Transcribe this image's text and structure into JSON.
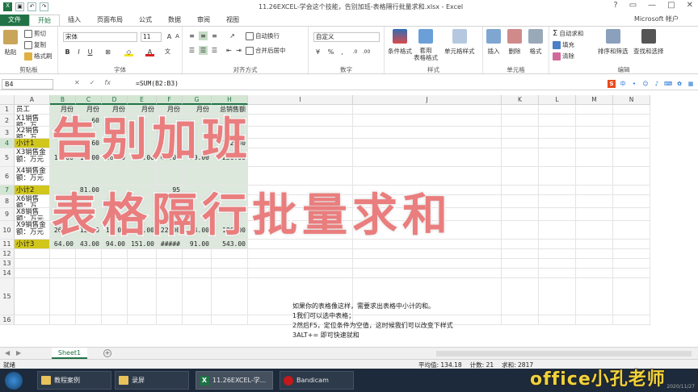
{
  "window": {
    "title": "11.26EXCEL-学会这个技能，告别加班-表格隔行批量求和.xlsx - Excel",
    "account": "Microsoft 帐户"
  },
  "tabs": [
    "文件",
    "开始",
    "插入",
    "页面布局",
    "公式",
    "数据",
    "审阅",
    "视图"
  ],
  "ribbon": {
    "clipboard": {
      "paste": "粘贴",
      "cut": "剪切",
      "copy": "复制",
      "format_painter": "格式刷",
      "label": "剪贴板"
    },
    "font": {
      "name": "宋体",
      "size": "11",
      "label": "字体"
    },
    "alignment": {
      "wrap": "自动换行",
      "merge": "合并后居中",
      "label": "对齐方式"
    },
    "number": {
      "format": "自定义",
      "label": "数字"
    },
    "styles": {
      "cond": "条件格式",
      "table": "套用\n表格格式",
      "cell": "单元格样式",
      "label": "样式"
    },
    "cells": {
      "insert": "插入",
      "delete": "删除",
      "format": "格式",
      "label": "单元格"
    },
    "editing": {
      "autosum": "自动求和",
      "fill": "填充",
      "clear": "清除",
      "sort": "排序和筛选",
      "find": "查找和选择",
      "label": "编辑"
    }
  },
  "formula_bar": {
    "name_box": "B4",
    "formula": "=SUM(B2:B3)"
  },
  "columns": [
    "A",
    "B",
    "C",
    "D",
    "E",
    "F",
    "G",
    "H",
    "I",
    "J",
    "K",
    "L",
    "M",
    "N"
  ],
  "rows": [
    {
      "n": "1",
      "a": "员工",
      "vals": [
        "月份",
        "月份",
        "月份",
        "月份",
        "月份",
        "月份",
        "总销售额"
      ]
    },
    {
      "n": "2",
      "a": "X1销售\n额：万",
      "vals": [
        "",
        "60",
        "",
        "",
        "",
        "",
        ""
      ]
    },
    {
      "n": "3",
      "a": "X2销售\n额：万",
      "vals": [
        "",
        "",
        "",
        "",
        "",
        "",
        ""
      ]
    },
    {
      "n": "4",
      "a": "小计1",
      "vals": [
        "",
        "9.60",
        "",
        "",
        "72",
        "",
        "1.2.30"
      ]
    },
    {
      "n": "5",
      "a": "X3销售金\n额：万元",
      "vals": [
        "12.00",
        "19.00",
        "56.00",
        "39.00",
        "60.00",
        "70.00",
        "256.00"
      ]
    },
    {
      "n": "6",
      "a": "X4销售金\n额：万元",
      "vals": [
        "",
        "",
        "",
        "",
        "",
        "",
        ""
      ]
    },
    {
      "n": "7",
      "a": "小计2",
      "vals": [
        "",
        "81.00",
        "",
        "",
        "95",
        "",
        ""
      ]
    },
    {
      "n": "8",
      "a": "X6销售\n额：万",
      "vals": [
        "",
        "",
        "",
        "",
        "",
        "",
        ""
      ]
    },
    {
      "n": "9",
      "a": "X8销售\n额：万元",
      "vals": [
        "",
        "",
        "",
        "",
        "",
        "",
        ""
      ]
    },
    {
      "n": "10",
      "a": "X9销售金\n额：万元",
      "vals": [
        "26.00",
        "12.00",
        "19.00",
        "39.00",
        "22.00",
        "34.00",
        "186.00"
      ]
    },
    {
      "n": "11",
      "a": "小计3",
      "vals": [
        "64.00",
        "43.00",
        "94.00",
        "151.00",
        "#####",
        "91.00",
        "543.00"
      ]
    },
    {
      "n": "12",
      "a": "",
      "vals": []
    },
    {
      "n": "13",
      "a": "",
      "vals": []
    },
    {
      "n": "14",
      "a": "",
      "vals": []
    },
    {
      "n": "15",
      "a": "",
      "vals": []
    },
    {
      "n": "16",
      "a": "",
      "vals": []
    }
  ],
  "note_lines": [
    "如果你的表格像这样，需要求出表格中小计的和。",
    "1我们可以选中表格；",
    "2然后F5，定位条件为空值，这时候我们可以改变下样式",
    "3ALT+= 即可快速就和"
  ],
  "overlay": {
    "line1": "告别加班",
    "line2": "表格隔行批量求和"
  },
  "sheet": {
    "tab": "Sheet1",
    "add": "+"
  },
  "status": {
    "ready": "就绪",
    "average": "平均值: 134.18",
    "count": "计数: 21",
    "sum": "求和: 2817"
  },
  "taskbar": {
    "items": [
      "教程案例",
      "录屏",
      "11.26EXCEL-学...",
      "Bandicam"
    ],
    "clock": "2020/11/27"
  },
  "watermark": "office小孔老师",
  "colors": {
    "excel_green": "#217346",
    "highlight_yellow": "#d0c61c",
    "overlay_pink": "#ea7d7d"
  }
}
